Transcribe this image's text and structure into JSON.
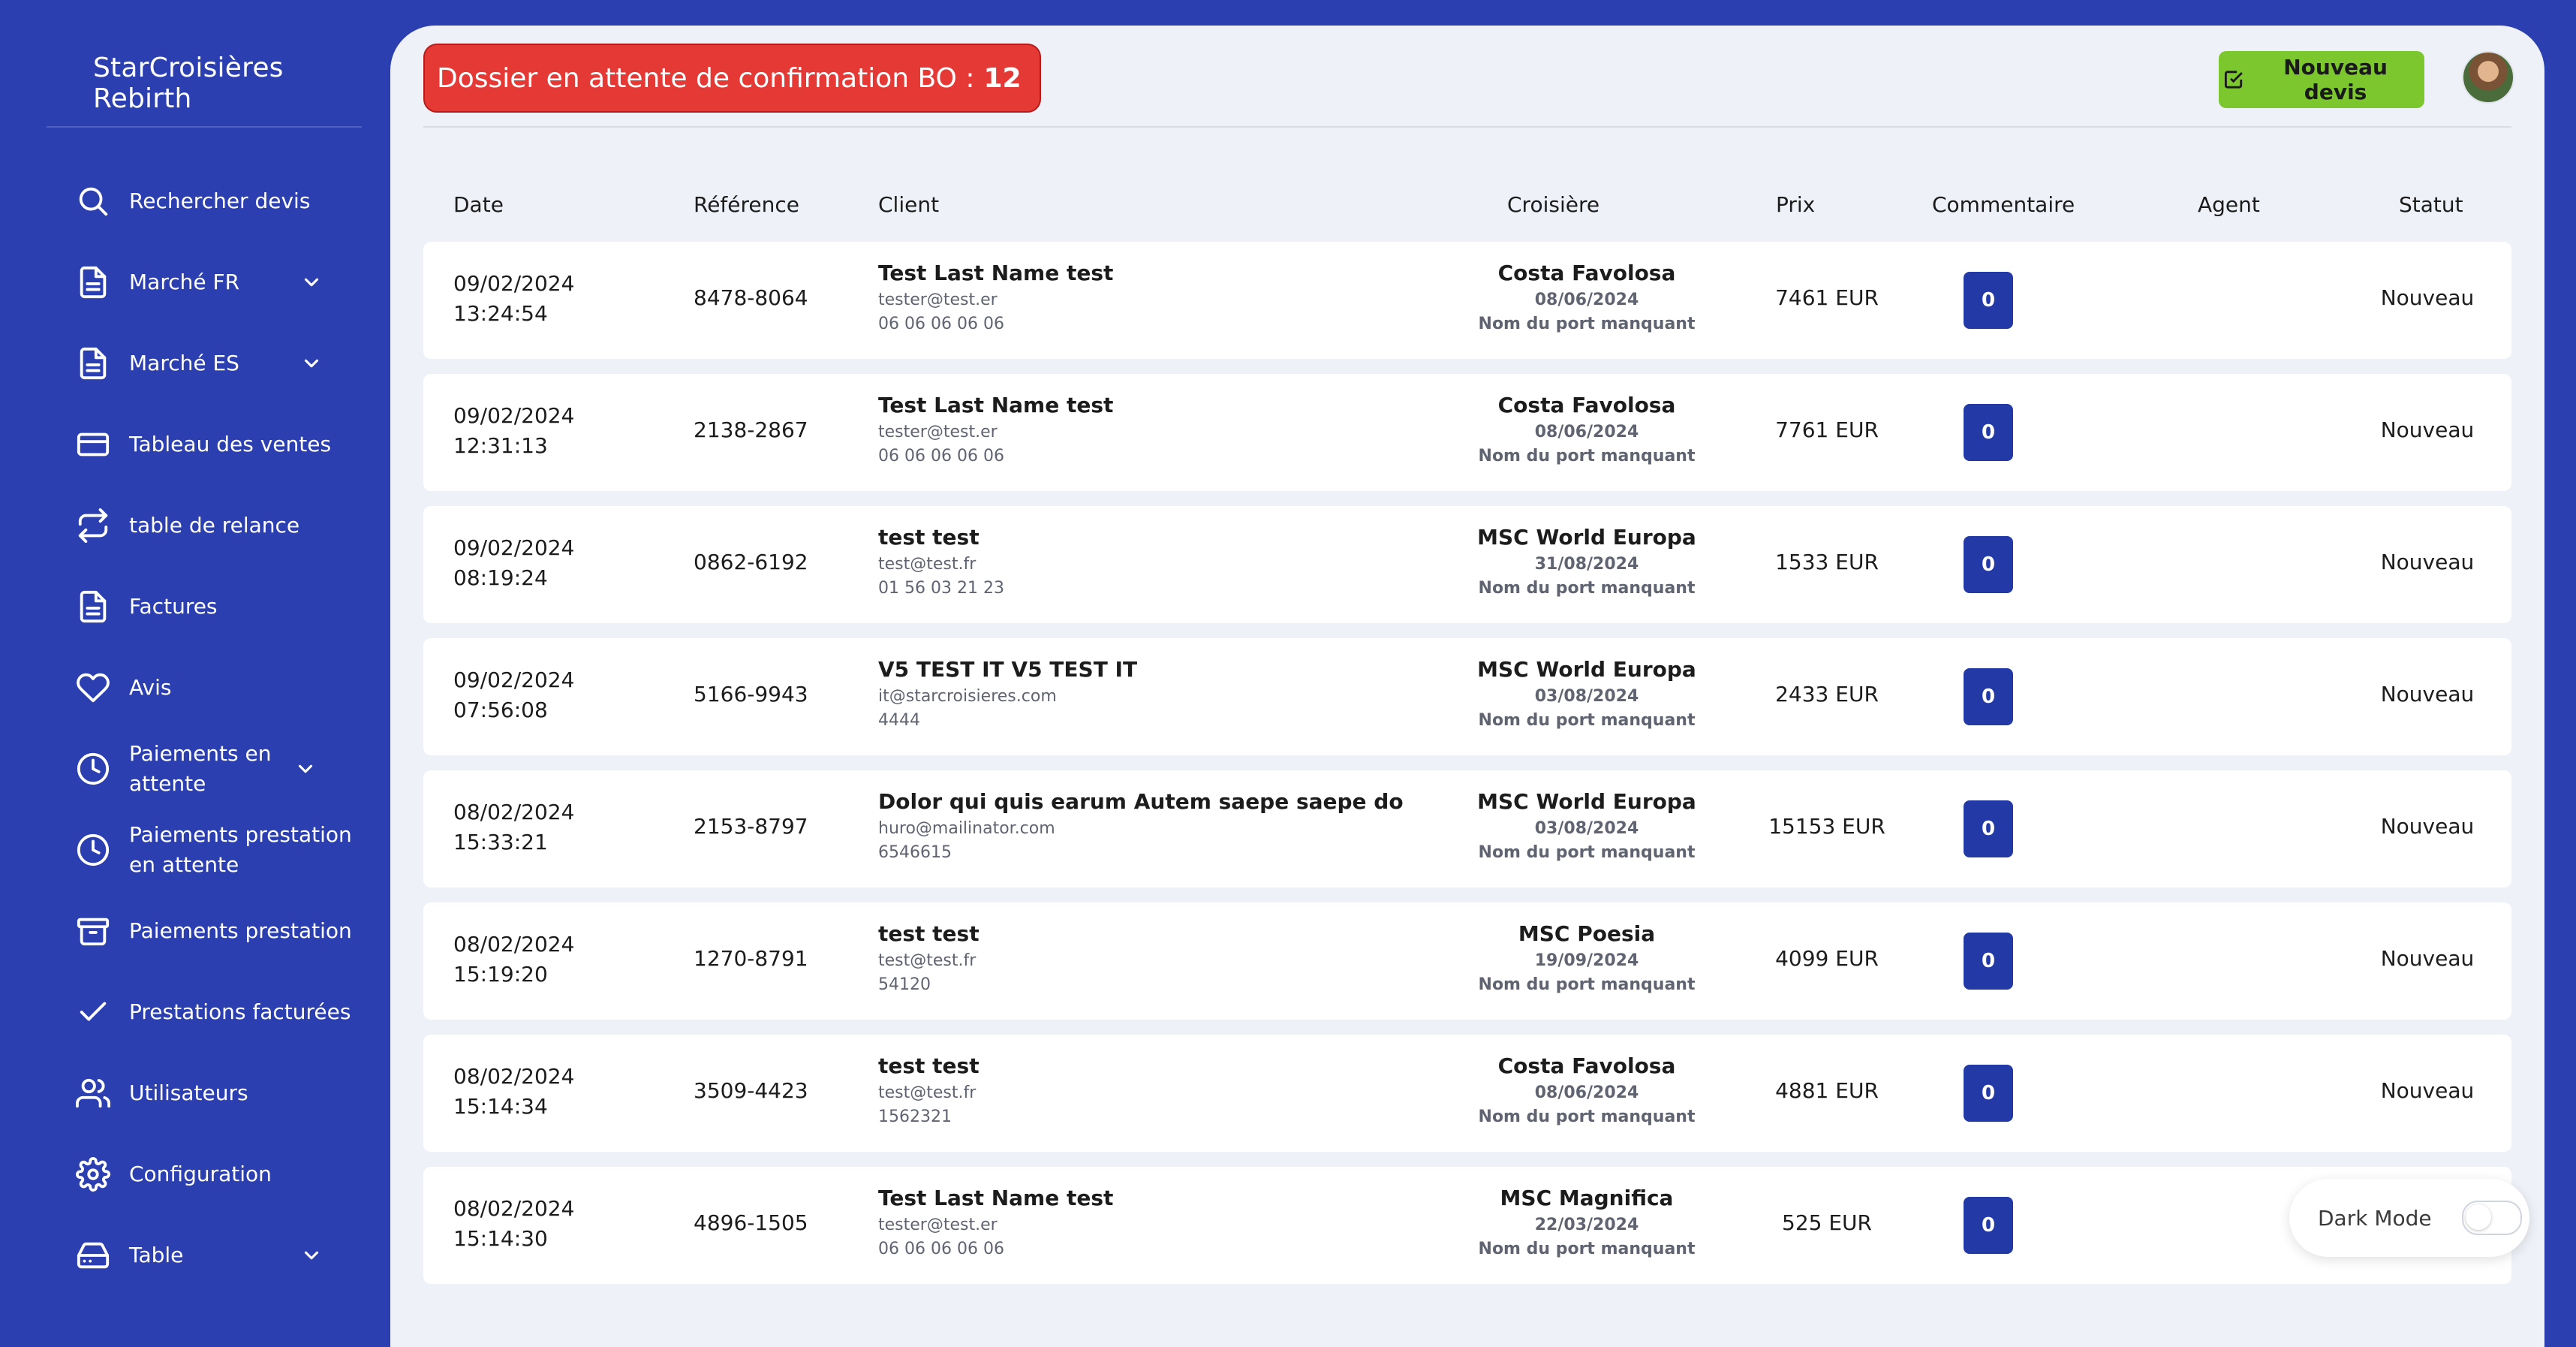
{
  "app": {
    "title": "StarCroisières Rebirth"
  },
  "sidebar": {
    "items": [
      {
        "label": "Rechercher devis",
        "icon": "search-icon",
        "chevron": false
      },
      {
        "label": "Marché FR",
        "icon": "document-icon",
        "chevron": true
      },
      {
        "label": "Marché ES",
        "icon": "document-icon",
        "chevron": true
      },
      {
        "label": "Tableau des ventes",
        "icon": "credit-card-icon",
        "chevron": false
      },
      {
        "label": "table de relance",
        "icon": "repeat-icon",
        "chevron": false
      },
      {
        "label": "Factures",
        "icon": "document-icon",
        "chevron": false
      },
      {
        "label": "Avis",
        "icon": "heart-icon",
        "chevron": false
      },
      {
        "label": "Paiements en attente",
        "icon": "clock-icon",
        "chevron": true
      },
      {
        "label": "Paiements prestation en attente",
        "icon": "clock-icon",
        "chevron": false
      },
      {
        "label": "Paiements prestation",
        "icon": "archive-icon",
        "chevron": false
      },
      {
        "label": "Prestations facturées",
        "icon": "check-icon",
        "chevron": false
      },
      {
        "label": "Utilisateurs",
        "icon": "users-icon",
        "chevron": false
      },
      {
        "label": "Configuration",
        "icon": "gear-icon",
        "chevron": false
      },
      {
        "label": "Table",
        "icon": "hard-drive-icon",
        "chevron": true
      }
    ]
  },
  "header": {
    "alert_text": "Dossier en attente de confirmation BO :",
    "alert_count": "12",
    "new_quote_label": "Nouveau devis"
  },
  "table": {
    "headers": {
      "date": "Date",
      "reference": "Référence",
      "client": "Client",
      "cruise": "Croisière",
      "price": "Prix",
      "comment": "Commentaire",
      "agent": "Agent",
      "status": "Statut"
    },
    "rows": [
      {
        "date": "09/02/2024",
        "time": "13:24:54",
        "ref": "8478-8064",
        "client_name": "Test Last Name test",
        "client_email": "tester@test.er",
        "client_phone": "06 06 06 06 06",
        "cruise_name": "Costa Favolosa",
        "cruise_date": "08/06/2024",
        "cruise_port": "Nom du port manquant",
        "price": "7461 EUR",
        "comments": "0",
        "agent": "",
        "status": "Nouveau"
      },
      {
        "date": "09/02/2024",
        "time": "12:31:13",
        "ref": "2138-2867",
        "client_name": "Test Last Name test",
        "client_email": "tester@test.er",
        "client_phone": "06 06 06 06 06",
        "cruise_name": "Costa Favolosa",
        "cruise_date": "08/06/2024",
        "cruise_port": "Nom du port manquant",
        "price": "7761 EUR",
        "comments": "0",
        "agent": "",
        "status": "Nouveau"
      },
      {
        "date": "09/02/2024",
        "time": "08:19:24",
        "ref": "0862-6192",
        "client_name": "test test",
        "client_email": "test@test.fr",
        "client_phone": "01 56 03 21 23",
        "cruise_name": "MSC World Europa",
        "cruise_date": "31/08/2024",
        "cruise_port": "Nom du port manquant",
        "price": "1533 EUR",
        "comments": "0",
        "agent": "",
        "status": "Nouveau"
      },
      {
        "date": "09/02/2024",
        "time": "07:56:08",
        "ref": "5166-9943",
        "client_name": "V5 TEST IT V5 TEST IT",
        "client_email": "it@starcroisieres.com",
        "client_phone": "4444",
        "cruise_name": "MSC World Europa",
        "cruise_date": "03/08/2024",
        "cruise_port": "Nom du port manquant",
        "price": "2433 EUR",
        "comments": "0",
        "agent": "",
        "status": "Nouveau"
      },
      {
        "date": "08/02/2024",
        "time": "15:33:21",
        "ref": "2153-8797",
        "client_name": "Dolor qui quis earum Autem saepe saepe do",
        "client_email": "huro@mailinator.com",
        "client_phone": "6546615",
        "cruise_name": "MSC World Europa",
        "cruise_date": "03/08/2024",
        "cruise_port": "Nom du port manquant",
        "price": "15153 EUR",
        "comments": "0",
        "agent": "",
        "status": "Nouveau"
      },
      {
        "date": "08/02/2024",
        "time": "15:19:20",
        "ref": "1270-8791",
        "client_name": "test test",
        "client_email": "test@test.fr",
        "client_phone": "54120",
        "cruise_name": "MSC Poesia",
        "cruise_date": "19/09/2024",
        "cruise_port": "Nom du port manquant",
        "price": "4099 EUR",
        "comments": "0",
        "agent": "",
        "status": "Nouveau"
      },
      {
        "date": "08/02/2024",
        "time": "15:14:34",
        "ref": "3509-4423",
        "client_name": "test test",
        "client_email": "test@test.fr",
        "client_phone": "1562321",
        "cruise_name": "Costa Favolosa",
        "cruise_date": "08/06/2024",
        "cruise_port": "Nom du port manquant",
        "price": "4881 EUR",
        "comments": "0",
        "agent": "",
        "status": "Nouveau"
      },
      {
        "date": "08/02/2024",
        "time": "15:14:30",
        "ref": "4896-1505",
        "client_name": "Test Last Name test",
        "client_email": "tester@test.er",
        "client_phone": "06 06 06 06 06",
        "cruise_name": "MSC Magnifica",
        "cruise_date": "22/03/2024",
        "cruise_port": "Nom du port manquant",
        "price": "525 EUR",
        "comments": "0",
        "agent": "",
        "status": ""
      }
    ]
  },
  "dark_mode": {
    "label": "Dark Mode",
    "enabled": false
  },
  "colors": {
    "sidebar_bg": "#2b3fb0",
    "alert": "#e53935",
    "accent_green": "#7cc62e",
    "comment_badge": "#2339a6"
  }
}
